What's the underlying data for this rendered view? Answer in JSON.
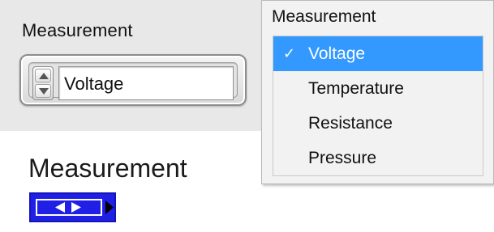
{
  "front_panel": {
    "control_label": "Measurement",
    "ring_value": "Voltage",
    "icons": {
      "increment": "triangle-up-icon",
      "decrement": "triangle-down-icon"
    }
  },
  "dropdown": {
    "header": "Measurement",
    "items": [
      {
        "label": "Voltage",
        "selected": true,
        "check": "✓"
      },
      {
        "label": "Temperature",
        "selected": false
      },
      {
        "label": "Resistance",
        "selected": false
      },
      {
        "label": "Pressure",
        "selected": false
      }
    ],
    "selection_color": "#3399ff"
  },
  "block_diagram": {
    "terminal_label": "Measurement",
    "terminal_color": "#1f1fe6",
    "icons": {
      "enum": "left-right-arrows-icon",
      "output": "arrow-right-icon"
    }
  }
}
